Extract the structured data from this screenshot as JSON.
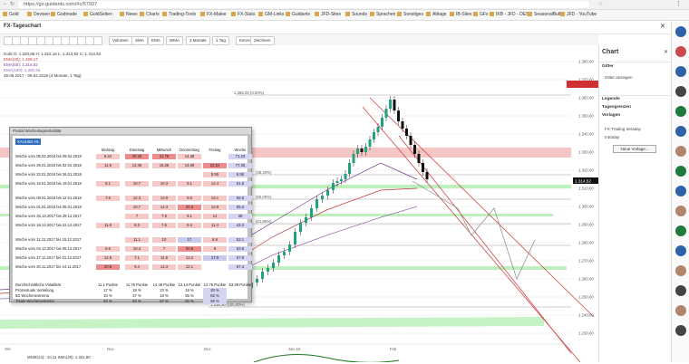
{
  "browser": {
    "url": "https://go.guidants.com/#c/57937",
    "bookmarks": [
      "Gold",
      "Devisen",
      "Godmode",
      "GoldSeiten",
      "News",
      "Charts",
      "Trading-Tools",
      "FX-Maker",
      "FX-Stats",
      "GM-Links",
      "Guidants",
      "JFD-Sites",
      "Sounds",
      "Sprachen",
      "Sonstiges",
      "Ablage",
      "IB-Sites",
      "GFs",
      "IKB - JFD - DESK",
      "SeasonalBull",
      "JFD - YouTube"
    ]
  },
  "app": {
    "title": "FX-Tageschart"
  },
  "chart_toolbar": {
    "buttons": [
      "Volumen",
      "SMA",
      "EMA",
      "WMA",
      "3 Monate",
      "1 Tag",
      "Kerze",
      "Zeichnen"
    ]
  },
  "legend": {
    "line1": "Gold  O: 1.320,86  H: 1.322,16  L: 1.313,82  C: 1.314,52",
    "line2": "EMA(20): 1.328,17",
    "line3": "EMA(50): 1.314,02",
    "line4": "EMA(100): 1.300,25",
    "line5": "29.09.2017 - 09.02.2018 (4 Monate, 1 Tag)"
  },
  "price_axis": [
    "1.380,00",
    "1.370,00",
    "1.360,00",
    "1.350,00",
    "1.340,00",
    "1.330,00",
    "1.320,00",
    "1.310,00",
    "1.300,00",
    "1.290,00",
    "1.280,00",
    "1.270,00",
    "1.260,00",
    "1.250,00",
    "1.240,00",
    "1.230,00"
  ],
  "current_price": "1.314,52",
  "date_axis": [
    "Okt",
    "Nov",
    "Dez",
    "Jan 18",
    "Feb"
  ],
  "fib_labels": [
    "1.366,00 (0,00%)",
    "(38,20%)",
    "(50,00%)",
    "(61,80%)",
    "1.236,30 (100,00%)"
  ],
  "indicator_label": "MOM(14): -10,11  SMA(20): 1.331,80",
  "right_panel": {
    "title": "Chart",
    "section_gitter": "Gitter",
    "gitter_show": "Gitter anzeigen",
    "section_legende": "Legende",
    "section_tagesgrenzen": "Tagesgrenzen",
    "section_vorlagen": "Vorlagen",
    "vorlage1": "FX-Trading Intraday",
    "vorlage2": "Intraday",
    "new_template": "Neue Vorlage..."
  },
  "stats_window": {
    "title": "Pivotal Wochentagsvolatilität",
    "selected": "XAUUSD H1",
    "headers": [
      "Montag",
      "Dienstag",
      "Mittwoch",
      "Donnerstag",
      "Freitag",
      "Woche"
    ],
    "rows": [
      {
        "label": "Woche vom 05.02.2018 bis 09.02.2018",
        "values": [
          "9.34",
          "20.29",
          "21.75",
          "14.38",
          "",
          "71.23"
        ],
        "heat": [
          1,
          3,
          3,
          1,
          0,
          2
        ]
      },
      {
        "label": "Woche vom 29.01.2018 bis 02.02.2018",
        "values": [
          "11.5",
          "13.45",
          "15.28",
          "14.69",
          "22.54",
          "77.26"
        ],
        "heat": [
          1,
          1,
          1,
          1,
          3,
          2
        ]
      },
      {
        "label": "Woche vom 22.01.2018 bis 26.01.2018",
        "values": [
          "",
          "",
          "",
          "",
          "5.95",
          "8.95"
        ],
        "heat": [
          0,
          0,
          0,
          0,
          1,
          2
        ]
      },
      {
        "label": "Woche vom 15.01.2018 bis 19.01.2018",
        "values": [
          "9.1",
          "10.7",
          "10.3",
          "9.1",
          "12.4",
          "51.6"
        ],
        "heat": [
          1,
          1,
          1,
          1,
          1,
          2
        ]
      },
      {
        "label": "Woche vom 08.01.2018 bis 12.01.2018",
        "values": [
          "7.6",
          "12.3",
          "13.9",
          "8.6",
          "13.1",
          "66.5"
        ],
        "heat": [
          1,
          1,
          1,
          1,
          1,
          2
        ]
      },
      {
        "label": "Woche vom 01.01.2018 bis 05.01.2018",
        "values": [
          "",
          "10.7",
          "14.3",
          "20.3",
          "13.9",
          "65.4"
        ],
        "heat": [
          0,
          1,
          1,
          3,
          1,
          2
        ]
      },
      {
        "label": "Woche vom 25.12.2017 bis 29.12.2017",
        "values": [
          "",
          "7",
          "7.9",
          "9.1",
          "14",
          "38"
        ],
        "heat": [
          0,
          1,
          1,
          1,
          1,
          2
        ]
      },
      {
        "label": "Woche vom 18.12.2017 bis 22.12.2017",
        "values": [
          "11.6",
          "6.3",
          "7.5",
          "8.4",
          "11.4",
          "43.2"
        ],
        "heat": [
          1,
          1,
          1,
          1,
          1,
          2
        ]
      },
      {
        "label": "Woche vom 11.12.2017 bis 15.12.2017",
        "values": [
          "",
          "11.1",
          "10",
          "17",
          "8.9",
          "53.1"
        ],
        "heat": [
          0,
          1,
          1,
          2,
          1,
          2
        ]
      },
      {
        "label": "Woche vom 04.12.2017 bis 08.12.2017",
        "values": [
          "6.6",
          "10.4",
          "7",
          "20.9",
          "9",
          "53.6"
        ],
        "heat": [
          1,
          1,
          1,
          3,
          1,
          2
        ]
      },
      {
        "label": "Woche vom 27.11.2017 bis 01.12.2017",
        "values": [
          "12.9",
          "7.1",
          "11.9",
          "13.2",
          "17.9",
          "67.9"
        ],
        "heat": [
          1,
          1,
          1,
          1,
          2,
          2
        ]
      },
      {
        "label": "Woche vom 20.11.2017 bis 24.11.2017",
        "values": [
          "20.9",
          "9.4",
          "14.3",
          "12.1",
          "",
          "57.4"
        ],
        "heat": [
          3,
          1,
          1,
          1,
          0,
          2
        ]
      }
    ],
    "summary": [
      {
        "label": "Durchschnittliche Volatilität",
        "values": [
          "11.1 Punkte",
          "11.76 Punkte",
          "14.48 Punkte",
          "12.14 Punkte",
          "12.75 Punkte",
          "53.09 Punkte"
        ]
      },
      {
        "label": "Prozentuale Verteilung",
        "values": [
          "17 %",
          "18 %",
          "23 %",
          "19 %",
          "20 %",
          ""
        ]
      },
      {
        "label": "5D Wochenextrema",
        "values": [
          "10 %",
          "47 %",
          "18 %",
          "55 %",
          "62 %",
          ""
        ]
      },
      {
        "label": "Totale Wochenextrema",
        "values": [
          "52 %",
          "52 %",
          "57 %",
          "55 %",
          "58 %",
          ""
        ]
      }
    ]
  }
}
